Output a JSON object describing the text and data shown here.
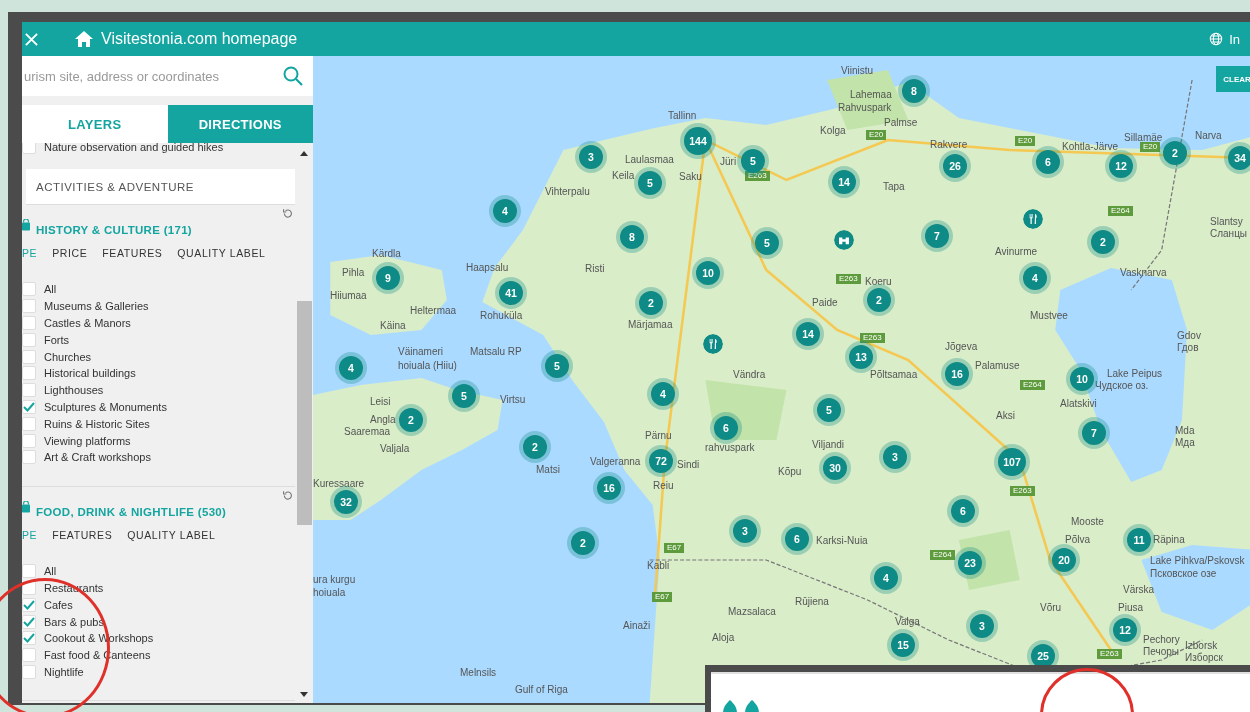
{
  "header": {
    "title": "Visitestonia.com homepage",
    "language": "In"
  },
  "search": {
    "placeholder": "urism site, address or coordinates"
  },
  "tabs": [
    {
      "label": "LAYERS",
      "selected": true
    },
    {
      "label": "DIRECTIONS",
      "selected": false
    }
  ],
  "layers": [
    {
      "kind": "option",
      "label": "Nature observation and guided hikes",
      "checked": false
    },
    {
      "kind": "category",
      "label": "ACTIVITIES & ADVENTURE",
      "expanded": false
    },
    {
      "kind": "category",
      "label": "HISTORY & CULTURE (171)",
      "expanded": true,
      "subtabs": [
        {
          "label": "PE",
          "selected": true
        },
        {
          "label": "PRICE",
          "selected": false
        },
        {
          "label": "FEATURES",
          "selected": false
        },
        {
          "label": "QUALITY LABEL",
          "selected": false
        }
      ],
      "options": [
        {
          "label": "All",
          "checked": false
        },
        {
          "label": "Museums & Galleries",
          "checked": false
        },
        {
          "label": "Castles & Manors",
          "checked": false
        },
        {
          "label": "Forts",
          "checked": false
        },
        {
          "label": "Churches",
          "checked": false
        },
        {
          "label": "Historical buildings",
          "checked": false
        },
        {
          "label": "Lighthouses",
          "checked": false
        },
        {
          "label": "Sculptures & Monuments",
          "checked": true
        },
        {
          "label": "Ruins & Historic Sites",
          "checked": false
        },
        {
          "label": "Viewing platforms",
          "checked": false
        },
        {
          "label": "Art & Craft workshops",
          "checked": false
        }
      ]
    },
    {
      "kind": "category",
      "label": "FOOD, DRINK & NIGHTLIFE (530)",
      "expanded": true,
      "subtabs": [
        {
          "label": "PE",
          "selected": true
        },
        {
          "label": "FEATURES",
          "selected": false
        },
        {
          "label": "QUALITY LABEL",
          "selected": false
        }
      ],
      "options": [
        {
          "label": "All",
          "checked": false
        },
        {
          "label": "Restaurants",
          "checked": false
        },
        {
          "label": "Cafes",
          "checked": true
        },
        {
          "label": "Bars & pubs",
          "checked": true
        },
        {
          "label": "Cookout & Workshops",
          "checked": true
        },
        {
          "label": "Fast food & Canteens",
          "checked": false
        },
        {
          "label": "Nightlife",
          "checked": false
        }
      ]
    }
  ],
  "map": {
    "clear_button": "CLEAR",
    "places": [
      "Viinistu",
      "Lahemaa",
      "Rahvuspark",
      "Tallinn",
      "Kolga",
      "Palmse",
      "Rakvere",
      "Kohtla-Järve",
      "Sillamäe",
      "Narva",
      "Laulasmaa",
      "Jüri",
      "Keila",
      "Saku",
      "Vihterpalu",
      "Tapa",
      "Slantsy",
      "Сланцы",
      "Kärdla",
      "Avinurme",
      "Pihla",
      "Haapsalu",
      "Risti",
      "Koeru",
      "Vasknarva",
      "Hiiumaa",
      "Heltermaa",
      "Paide",
      "Käina",
      "Rohuküla",
      "Märjamaa",
      "Mustvee",
      "Gdov",
      "Väinameri",
      "Matsalu RP",
      "Jõgeva",
      "Гдов",
      "hoiuala (Hiiu)",
      "Vändra",
      "Põltsamaa",
      "Palamuse",
      "Lake Peipus",
      "Чудское оз.",
      "Leisi",
      "Virtsu",
      "Alatskivi",
      "Angla",
      "Aksi",
      "Saaremaa",
      "Pärnu",
      "Mda",
      "Valjala",
      "rahvuspark",
      "Viljandi",
      "Мда",
      "Matsi",
      "Valgeranna",
      "Sindi",
      "Kõpu",
      "Kuressaare",
      "Reiu",
      "Mooste",
      "Karksi-Nuia",
      "Põlva",
      "Räpina",
      "Kabli",
      "Lake Pihkva/Pskovsk",
      "ura kurgu",
      "Псковское озе",
      "hoiuala",
      "Värska",
      "Mazsalaca",
      "Rūjiena",
      "Võru",
      "Piusa",
      "Ainaži",
      "Valga",
      "Aloja",
      "Pechory",
      "Печоры",
      "Izborsk",
      "Изборск",
      "Melnsils",
      "Gulf of Riga"
    ],
    "roads": [
      "E20",
      "E20",
      "E20",
      "E263",
      "E264",
      "E263",
      "E263",
      "E264",
      "E263",
      "E67",
      "E264",
      "E67",
      "E263"
    ],
    "markers": [
      {
        "kind": "cluster",
        "label": "8"
      },
      {
        "kind": "cluster",
        "label": "144"
      },
      {
        "kind": "cluster",
        "label": "3"
      },
      {
        "kind": "cluster",
        "label": "5"
      },
      {
        "kind": "cluster",
        "label": "26"
      },
      {
        "kind": "cluster",
        "label": "6"
      },
      {
        "kind": "cluster",
        "label": "12"
      },
      {
        "kind": "cluster",
        "label": "2"
      },
      {
        "kind": "cluster",
        "label": "34"
      },
      {
        "kind": "cluster",
        "label": "5"
      },
      {
        "kind": "cluster",
        "label": "14"
      },
      {
        "kind": "cluster",
        "label": "4"
      },
      {
        "kind": "restaurant"
      },
      {
        "kind": "cluster",
        "label": "8"
      },
      {
        "kind": "cluster",
        "label": "5"
      },
      {
        "kind": "binoculars"
      },
      {
        "kind": "cluster",
        "label": "7"
      },
      {
        "kind": "cluster",
        "label": "2"
      },
      {
        "kind": "cluster",
        "label": "9"
      },
      {
        "kind": "cluster",
        "label": "10"
      },
      {
        "kind": "cluster",
        "label": "4"
      },
      {
        "kind": "cluster",
        "label": "41"
      },
      {
        "kind": "cluster",
        "label": "2"
      },
      {
        "kind": "cluster",
        "label": "2"
      },
      {
        "kind": "restaurant"
      },
      {
        "kind": "cluster",
        "label": "14"
      },
      {
        "kind": "cluster",
        "label": "4"
      },
      {
        "kind": "cluster",
        "label": "5"
      },
      {
        "kind": "cluster",
        "label": "13"
      },
      {
        "kind": "cluster",
        "label": "16"
      },
      {
        "kind": "cluster",
        "label": "10"
      },
      {
        "kind": "cluster",
        "label": "5"
      },
      {
        "kind": "cluster",
        "label": "4"
      },
      {
        "kind": "cluster",
        "label": "2"
      },
      {
        "kind": "cluster",
        "label": "5"
      },
      {
        "kind": "cluster",
        "label": "6"
      },
      {
        "kind": "cluster",
        "label": "7"
      },
      {
        "kind": "cluster",
        "label": "2"
      },
      {
        "kind": "cluster",
        "label": "72"
      },
      {
        "kind": "cluster",
        "label": "30"
      },
      {
        "kind": "cluster",
        "label": "3"
      },
      {
        "kind": "cluster",
        "label": "107"
      },
      {
        "kind": "cluster",
        "label": "16"
      },
      {
        "kind": "cluster",
        "label": "32"
      },
      {
        "kind": "cluster",
        "label": "6"
      },
      {
        "kind": "cluster",
        "label": "2"
      },
      {
        "kind": "cluster",
        "label": "3"
      },
      {
        "kind": "cluster",
        "label": "6"
      },
      {
        "kind": "cluster",
        "label": "11"
      },
      {
        "kind": "cluster",
        "label": "23"
      },
      {
        "kind": "cluster",
        "label": "20"
      },
      {
        "kind": "cluster",
        "label": "4"
      },
      {
        "kind": "cluster",
        "label": "3"
      },
      {
        "kind": "cluster",
        "label": "12"
      },
      {
        "kind": "cluster",
        "label": "15"
      },
      {
        "kind": "cluster",
        "label": "25"
      }
    ]
  }
}
